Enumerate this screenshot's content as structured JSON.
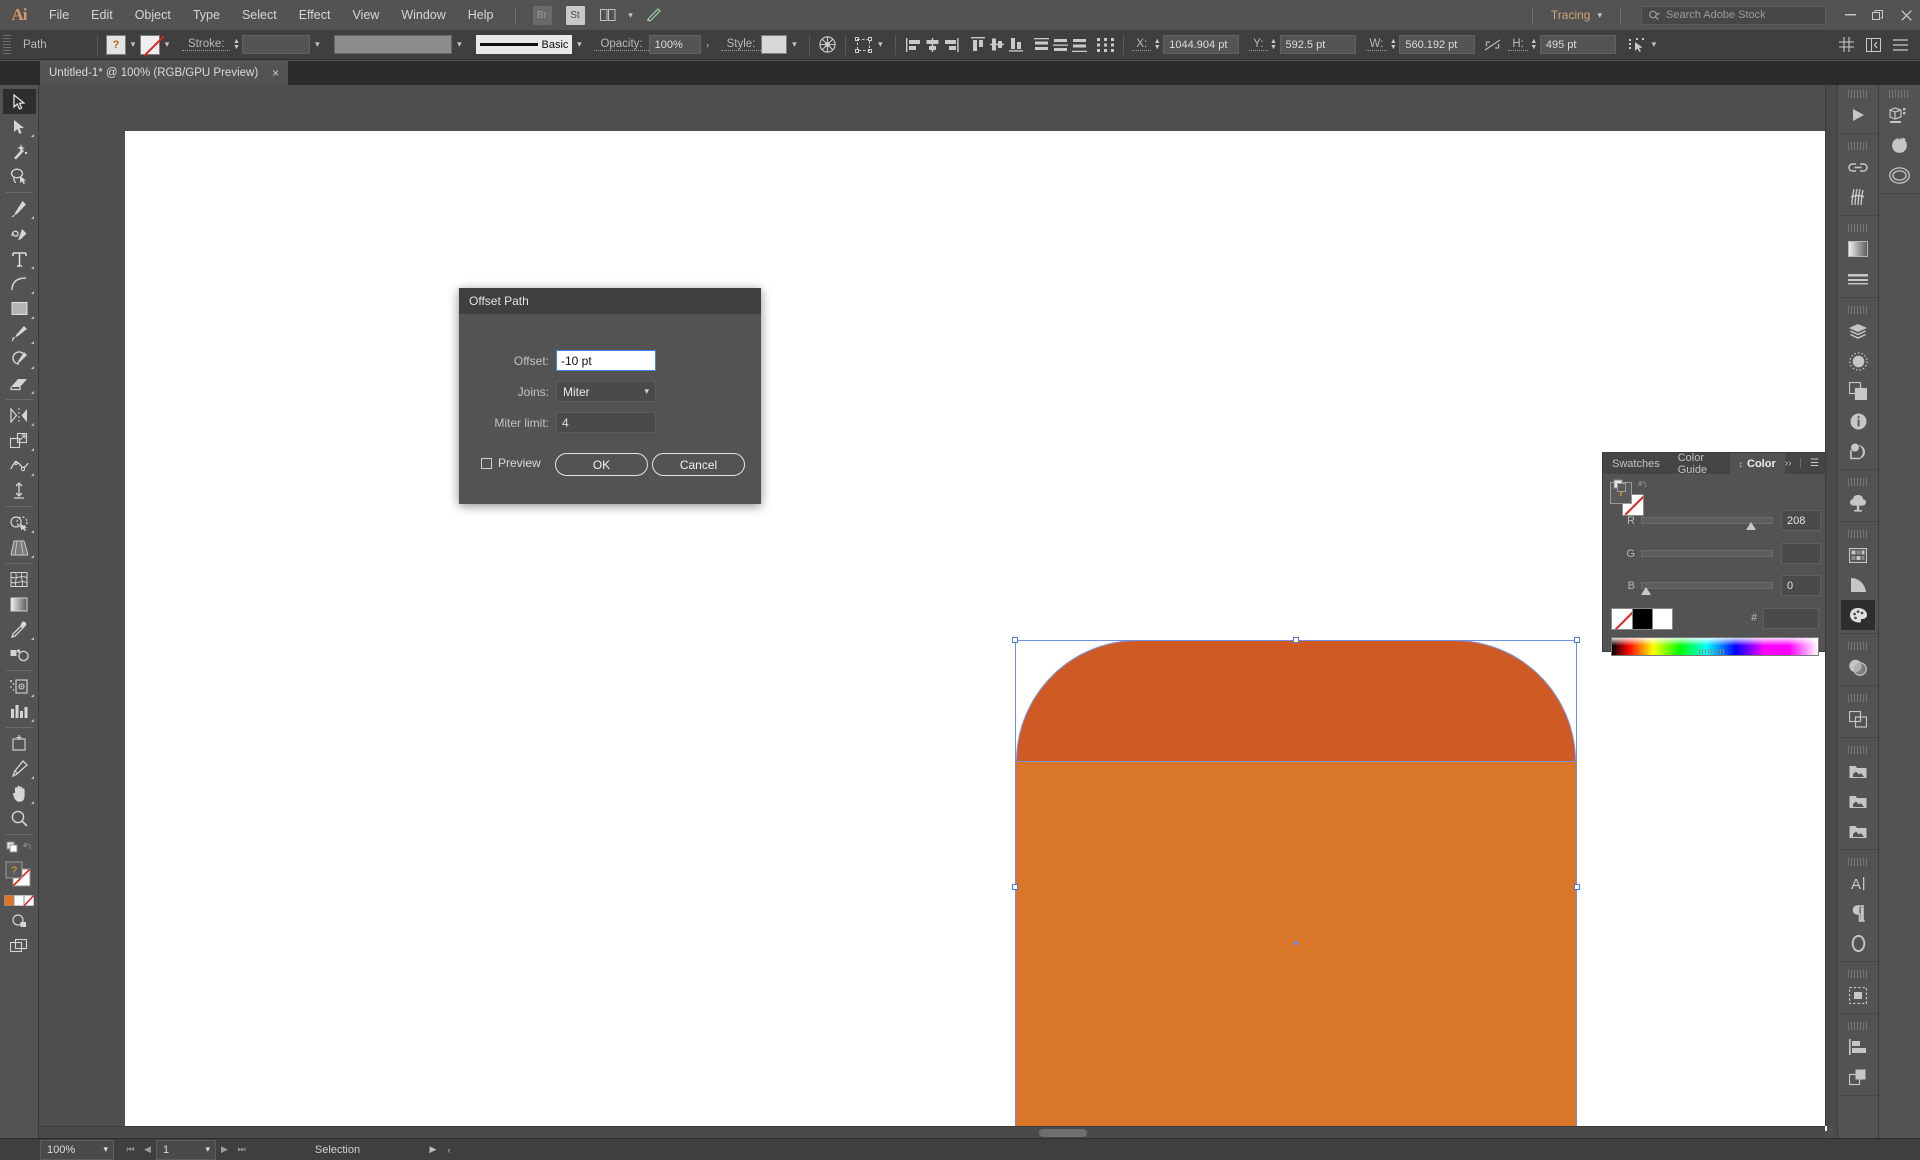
{
  "app": {
    "logo": "Ai",
    "menus": [
      "File",
      "Edit",
      "Object",
      "Type",
      "Select",
      "Effect",
      "View",
      "Window",
      "Help"
    ],
    "quick_buttons": [
      "Br",
      "St"
    ],
    "workspace": "Tracing",
    "search_placeholder": "Search Adobe Stock",
    "window_buttons": [
      "minimize",
      "restore",
      "close"
    ]
  },
  "controlbar": {
    "object_type": "Path",
    "fill_label": "?",
    "stroke_label": "Stroke:",
    "stroke_weight": "",
    "stroke_profile": "",
    "brush_label": "Basic",
    "opacity_label": "Opacity:",
    "opacity_value": "100%",
    "style_label": "Style:",
    "x_label": "X:",
    "x_value": "1044.904 pt",
    "y_label": "Y:",
    "y_value": "592.5 pt",
    "w_label": "W:",
    "w_value": "560.192 pt",
    "h_label": "H:",
    "h_value": "495 pt"
  },
  "document": {
    "tab_title": "Untitled-1* @ 100% (RGB/GPU Preview)",
    "close_glyph": "×"
  },
  "tools": {
    "items": [
      {
        "name": "selection-tool",
        "selected": true,
        "flyout": false
      },
      {
        "name": "direct-selection-tool",
        "selected": false,
        "flyout": true
      },
      {
        "name": "magic-wand-tool",
        "selected": false,
        "flyout": false
      },
      {
        "name": "lasso-tool",
        "selected": false,
        "flyout": false
      },
      {
        "name": "pen-tool",
        "selected": false,
        "flyout": true
      },
      {
        "name": "curvature-tool",
        "selected": false,
        "flyout": false
      },
      {
        "name": "type-tool",
        "selected": false,
        "flyout": true
      },
      {
        "name": "line-segment-tool",
        "selected": false,
        "flyout": true
      },
      {
        "name": "rectangle-tool",
        "selected": false,
        "flyout": true
      },
      {
        "name": "paintbrush-tool",
        "selected": false,
        "flyout": true
      },
      {
        "name": "shaper-tool",
        "selected": false,
        "flyout": true
      },
      {
        "name": "eraser-tool",
        "selected": false,
        "flyout": true
      },
      {
        "name": "rotate-tool",
        "selected": false,
        "flyout": true
      },
      {
        "name": "scale-tool",
        "selected": false,
        "flyout": true
      },
      {
        "name": "width-tool",
        "selected": false,
        "flyout": true
      },
      {
        "name": "free-transform-tool",
        "selected": false,
        "flyout": false
      },
      {
        "name": "shape-builder-tool",
        "selected": false,
        "flyout": true
      },
      {
        "name": "perspective-grid-tool",
        "selected": false,
        "flyout": true
      },
      {
        "name": "mesh-tool",
        "selected": false,
        "flyout": false
      },
      {
        "name": "gradient-tool",
        "selected": false,
        "flyout": false
      },
      {
        "name": "eyedropper-tool",
        "selected": false,
        "flyout": true
      },
      {
        "name": "blend-tool",
        "selected": false,
        "flyout": false
      },
      {
        "name": "symbol-sprayer-tool",
        "selected": false,
        "flyout": true
      },
      {
        "name": "column-graph-tool",
        "selected": false,
        "flyout": true
      },
      {
        "name": "artboard-tool",
        "selected": false,
        "flyout": false
      },
      {
        "name": "slice-tool",
        "selected": false,
        "flyout": true
      },
      {
        "name": "hand-tool",
        "selected": false,
        "flyout": true
      },
      {
        "name": "zoom-tool",
        "selected": false,
        "flyout": false
      }
    ],
    "fill_stroke_label": "?"
  },
  "dialog": {
    "title": "Offset Path",
    "offset_label": "Offset:",
    "offset_value": "-10 pt",
    "joins_label": "Joins:",
    "joins_value": "Miter",
    "miter_label": "Miter limit:",
    "miter_value": "4",
    "preview_label": "Preview",
    "preview_checked": false,
    "ok_label": "OK",
    "cancel_label": "Cancel"
  },
  "color_panel": {
    "tabs": [
      "Swatches",
      "Color Guide",
      "Color"
    ],
    "active_tab": "Color",
    "expand_glyph": "››",
    "menu_glyph": "☰",
    "channels": [
      {
        "label": "R",
        "value": "208",
        "pct": 82
      },
      {
        "label": "G",
        "value": "",
        "pct": 0
      },
      {
        "label": "B",
        "value": "0",
        "pct": 1
      }
    ],
    "hex_label": "#",
    "hex_value": ""
  },
  "artwork": {
    "fill_body": "#d9762a",
    "fill_dome": "#cf5a23",
    "selection_color": "#6f8fe8"
  },
  "right_dock": {
    "column_a": [
      "play-icon",
      "link-icon",
      "brushes-icon",
      "gradient-icon",
      "stroke-icon",
      "layers-icon",
      "appearance-icon",
      "transform-icon",
      "info-icon",
      "pathfinder-icon",
      "symbols-icon",
      "swatches-icon",
      "color-guide-icon",
      "color-icon",
      "transparency-icon",
      "align-icon",
      "libraries-icon",
      "libraries-2-icon",
      "libraries-3-icon",
      "character-icon",
      "paragraph-icon",
      "glyphs-icon",
      "artboards-icon",
      "align-panel-icon",
      "pathfinder-panel-icon"
    ],
    "column_b": [
      "3d-icon",
      "refresh-icon",
      "cc-libraries-icon"
    ]
  },
  "statusbar": {
    "zoom": "100%",
    "page": "1",
    "status": "Selection"
  }
}
